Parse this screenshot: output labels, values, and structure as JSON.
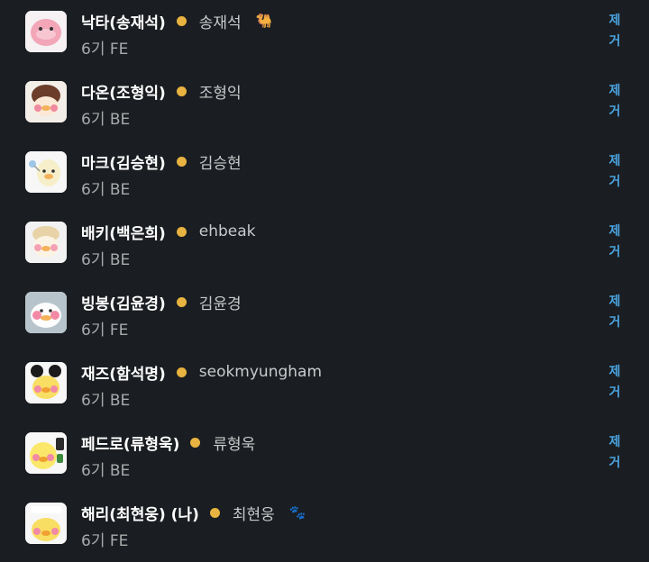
{
  "colors": {
    "background": "#1a1d21",
    "name": "#ffffff",
    "status_dot": "#e8b340",
    "action": "#4aa3df"
  },
  "members": [
    {
      "name": "낙타(송재석)",
      "handle": "송재석",
      "status_emoji": "🐫",
      "status_icon": "camel-icon",
      "sub": "6기 FE",
      "remove_char1": "제",
      "remove_char2": "거"
    },
    {
      "name": "다온(조형익)",
      "handle": "조형익",
      "status_emoji": "",
      "sub": "6기 BE",
      "remove_char1": "제",
      "remove_char2": "거"
    },
    {
      "name": "마크(김승현)",
      "handle": "김승현",
      "status_emoji": "",
      "sub": "6기 BE",
      "remove_char1": "제",
      "remove_char2": "거"
    },
    {
      "name": "배키(백은희)",
      "handle": "ehbeak",
      "status_emoji": "",
      "sub": "6기 BE",
      "remove_char1": "제",
      "remove_char2": "거"
    },
    {
      "name": "빙봉(김윤경)",
      "handle": "김윤경",
      "status_emoji": "",
      "sub": "6기 FE",
      "remove_char1": "제",
      "remove_char2": "거"
    },
    {
      "name": "재즈(함석명)",
      "handle": "seokmyungham",
      "status_emoji": "",
      "sub": "6기 BE",
      "remove_char1": "제",
      "remove_char2": "거"
    },
    {
      "name": "페드로(류형욱)",
      "handle": "류형욱",
      "status_emoji": "",
      "sub": "6기 BE",
      "remove_char1": "제",
      "remove_char2": "거"
    },
    {
      "name": "해리(최현웅) (나)",
      "handle": "최현웅",
      "status_emoji": "🐾",
      "status_icon": "paw-prints-icon",
      "sub": "6기 FE",
      "remove_char1": "",
      "remove_char2": ""
    }
  ]
}
